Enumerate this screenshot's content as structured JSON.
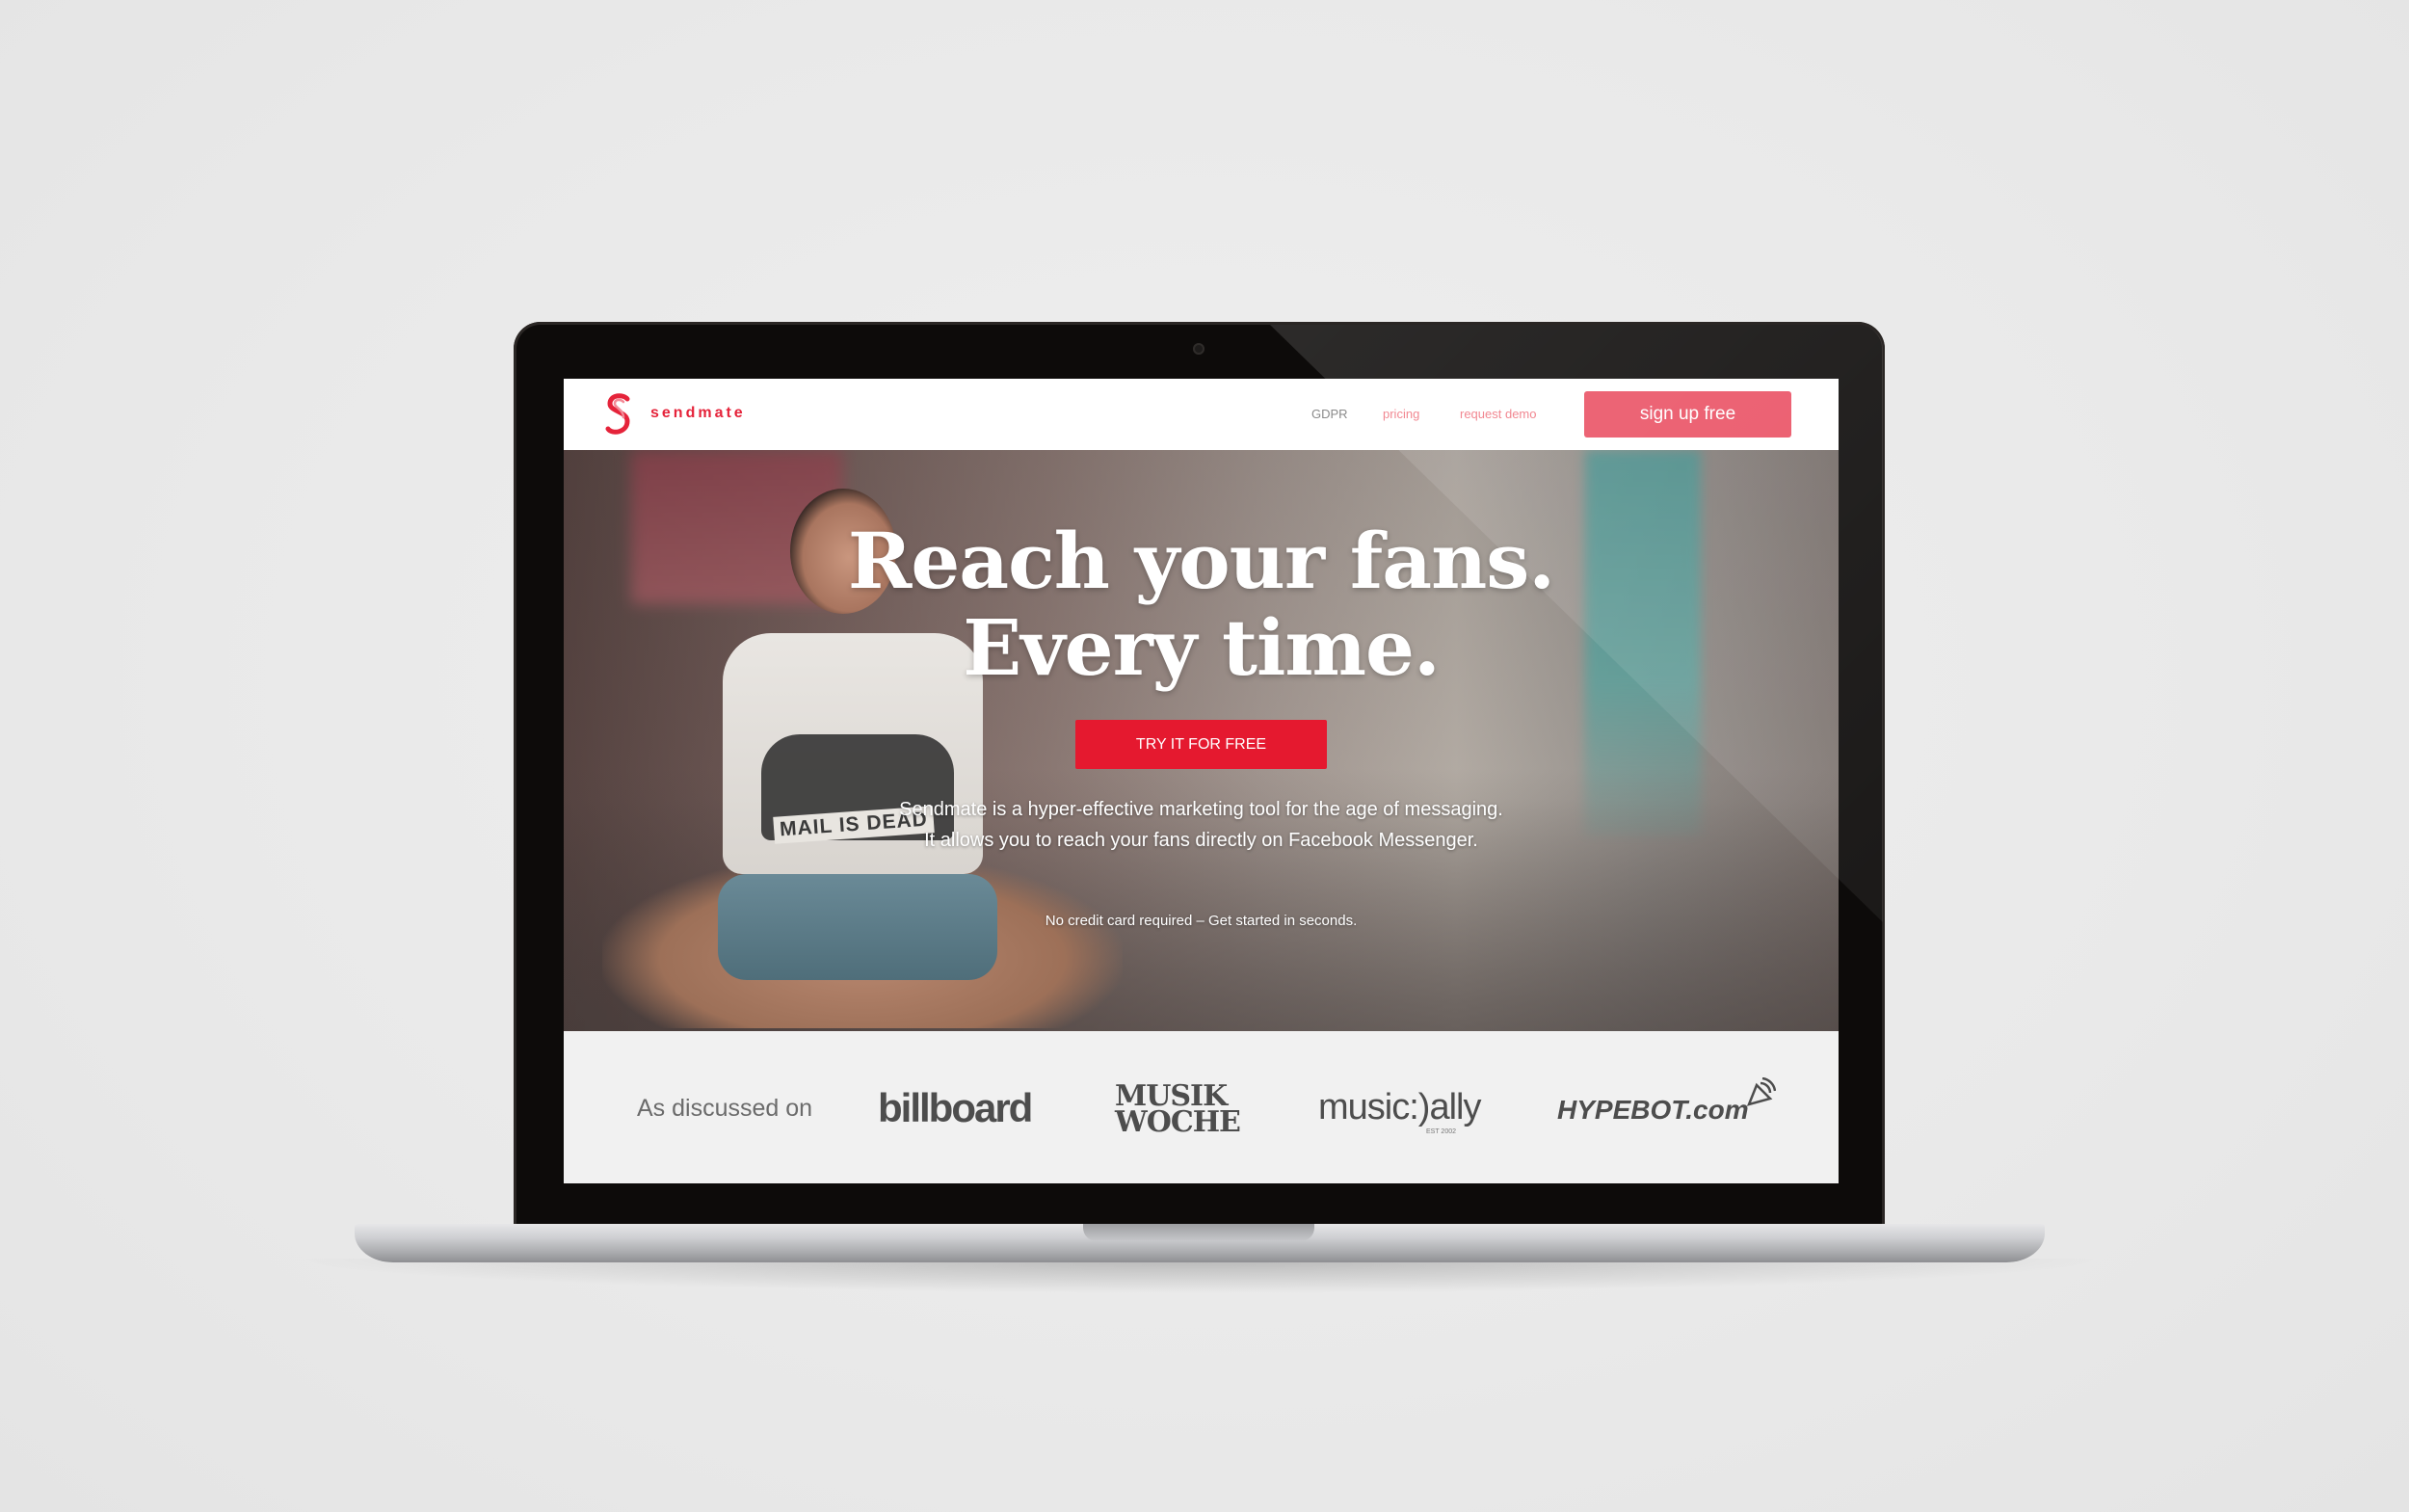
{
  "brand": {
    "name": "sendmate",
    "accent_color": "#e5233a",
    "button_color": "#ea5265",
    "cta_color": "#e5192f"
  },
  "nav": {
    "gdpr": "GDPR",
    "pricing": "pricing",
    "request_demo": "request demo",
    "signup": "sign up free"
  },
  "hero": {
    "title_line1": "Reach your fans.",
    "title_line2": "Every time.",
    "cta": "TRY IT FOR FREE",
    "desc_line1": "Sendmate is a hyper-effective marketing tool for the age of messaging.",
    "desc_line2": "It allows you to reach your fans directly on Facebook Messenger.",
    "note": "No credit card required – Get started in seconds.",
    "shirt_text": "MAIL IS DEAD"
  },
  "press": {
    "label": "As discussed on",
    "logos": {
      "billboard": "billboard",
      "musik_line1": "MUSIK",
      "musik_line2": "WOCHE",
      "musically": "music:)ally",
      "musically_sub": "EST 2002",
      "hypebot": "HYPEBOT.com"
    }
  }
}
